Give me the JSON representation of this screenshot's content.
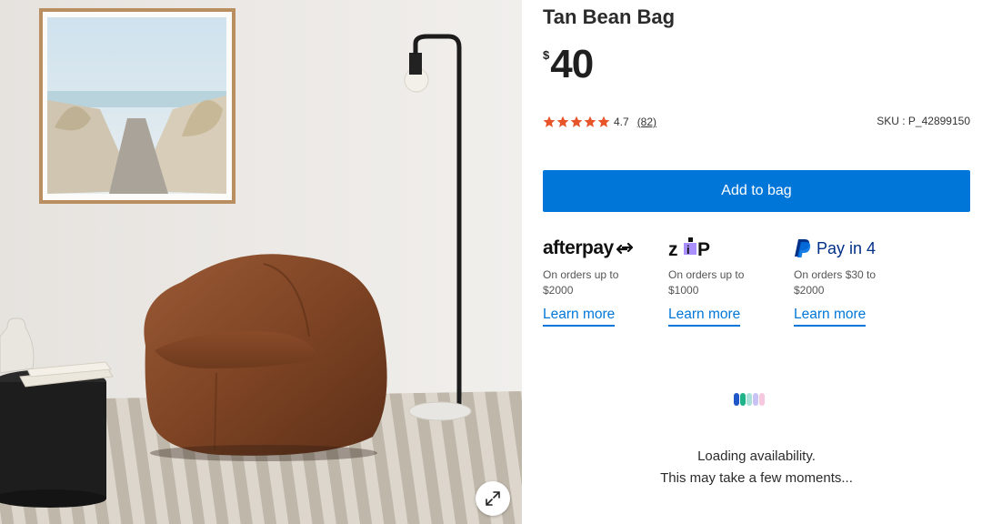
{
  "product": {
    "title": "Tan Bean Bag",
    "currency": "$",
    "price": "40",
    "rating": "4.7",
    "rating_stars": 4.7,
    "review_count": "(82)",
    "sku": "SKU : P_42899150",
    "add_to_bag_label": "Add to bag"
  },
  "payments": [
    {
      "brand": "afterpay",
      "logo_text": "afterpay",
      "desc": "On orders up to $2000",
      "link": "Learn more"
    },
    {
      "brand": "zip",
      "logo_text": "zip",
      "desc": "On orders up to $1000",
      "link": "Learn more"
    },
    {
      "brand": "paypal",
      "logo_text": "Pay in 4",
      "desc": "On orders $30 to $2000",
      "link": "Learn more"
    }
  ],
  "availability": {
    "line1": "Loading availability.",
    "line2": "This may take a few moments..."
  },
  "icons": {
    "star": "star-icon",
    "expand": "expand-icon",
    "afterpay": "afterpay-logo",
    "zip": "zip-logo",
    "paypal": "paypal-icon"
  },
  "colors": {
    "accent": "#0077d8",
    "star": "#e8542a",
    "loader": [
      "#1f56c8",
      "#1fb38a",
      "#a9e0d9",
      "#c9c3f5",
      "#f6c8df"
    ]
  }
}
